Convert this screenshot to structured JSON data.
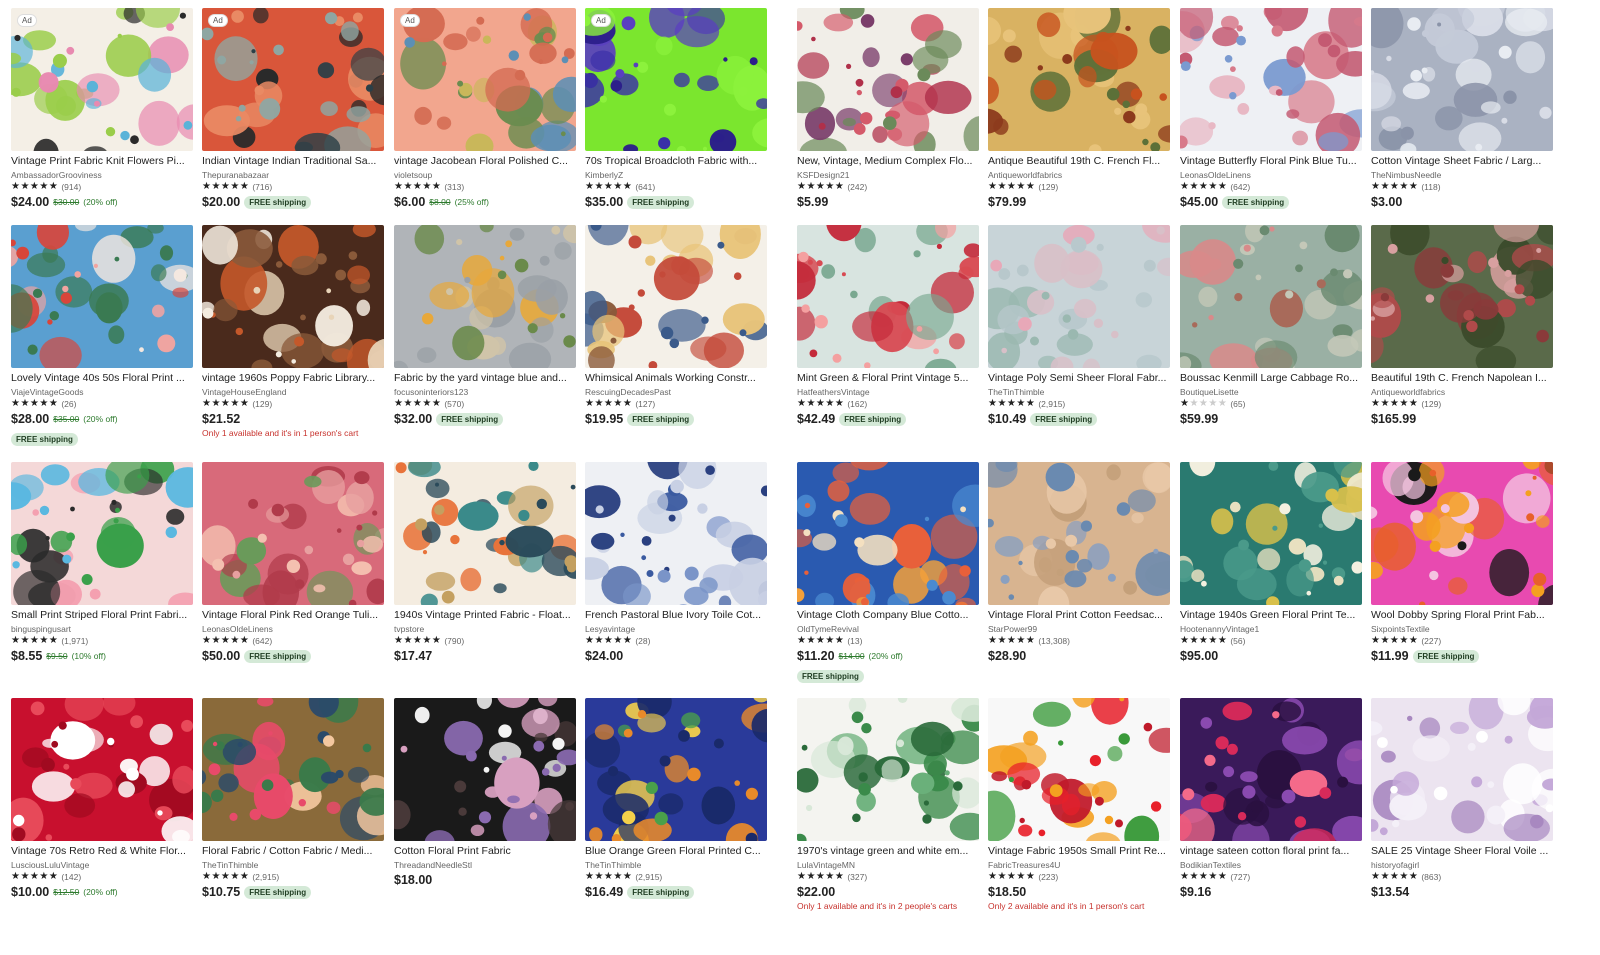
{
  "icons": {
    "star": "star-icon"
  },
  "colors": {
    "sale_green": "#2d7a2d",
    "badge_bg": "#d4e9d7",
    "alert_red": "#c7322d"
  },
  "free_shipping_label": "FREE shipping",
  "ad_label": "Ad",
  "listings": [
    {
      "title": "Vintage Print Fabric Knit Flowers Pi...",
      "shop": "AmbassadorGrooviness",
      "stars": 5,
      "reviews": "(914)",
      "price": "$24.00",
      "orig": "$30.00",
      "off": "(20% off)",
      "free": false,
      "ad": true,
      "alert": "",
      "pal": [
        "#f4efe6",
        "#5ab3d8",
        "#e88ab0",
        "#9acd4a",
        "#2a2a2a"
      ]
    },
    {
      "title": "Indian Vintage Indian Traditional Sa...",
      "shop": "Thepuranabazaar",
      "stars": 4.5,
      "reviews": "(716)",
      "price": "$20.00",
      "orig": "",
      "off": "",
      "free": true,
      "ad": true,
      "alert": "",
      "pal": [
        "#d9563a",
        "#2b3f47",
        "#8fa6a2",
        "#e98a64",
        "#2a2a2a"
      ]
    },
    {
      "title": "vintage Jacobean Floral Polished C...",
      "shop": "violetsoup",
      "stars": 5,
      "reviews": "(313)",
      "price": "$6.00",
      "orig": "$8.00",
      "off": "(25% off)",
      "free": false,
      "ad": true,
      "alert": "",
      "pal": [
        "#f2a68e",
        "#5c8fb5",
        "#c9b75a",
        "#6a8c4f",
        "#d46b52"
      ]
    },
    {
      "title": "70s Tropical Broadcloth Fabric with...",
      "shop": "KimberlyZ",
      "stars": 5,
      "reviews": "(641)",
      "price": "$35.00",
      "orig": "",
      "off": "",
      "free": true,
      "ad": true,
      "alert": "",
      "pal": [
        "#7be62e",
        "#3a2fa8",
        "#5a3fc0",
        "#8cf23c",
        "#2c1f8a"
      ]
    },
    {
      "title": "New, Vintage, Medium Complex Flo...",
      "shop": "KSFDesign21",
      "stars": 5,
      "reviews": "(242)",
      "price": "$5.99",
      "orig": "",
      "off": "",
      "free": false,
      "ad": false,
      "alert": "",
      "pal": [
        "#f1eee8",
        "#b0304a",
        "#6b8a5a",
        "#7b3e6b",
        "#d45a6a"
      ]
    },
    {
      "title": "Antique Beautiful 19th C. French Fl...",
      "shop": "Antiqueworldfabrics",
      "stars": 5,
      "reviews": "(129)",
      "price": "$79.99",
      "orig": "",
      "off": "",
      "free": false,
      "ad": false,
      "alert": "",
      "pal": [
        "#d9b262",
        "#c7521e",
        "#5c7038",
        "#8c3a1c",
        "#e8c37a"
      ]
    },
    {
      "title": "Vintage Butterfly Floral Pink Blue Tu...",
      "shop": "LeonasOldeLinens",
      "stars": 5,
      "reviews": "(642)",
      "price": "$45.00",
      "orig": "",
      "off": "",
      "free": true,
      "ad": false,
      "alert": "",
      "pal": [
        "#eef0f4",
        "#d87a8a",
        "#7a9ad0",
        "#e8b8c4",
        "#c45a72"
      ]
    },
    {
      "title": "Cotton Vintage Sheet Fabric / Larg...",
      "shop": "TheNimbusNeedle",
      "stars": 5,
      "reviews": "(118)",
      "price": "$3.00",
      "orig": "",
      "off": "",
      "free": false,
      "ad": false,
      "alert": "",
      "pal": [
        "#aab2c2",
        "#d8dce6",
        "#8a93a8",
        "#c4cad8",
        "#e8ecf2"
      ]
    },
    {
      "title": "Lovely Vintage 40s 50s Floral Print ...",
      "shop": "ViajeVintageGoods",
      "stars": 5,
      "reviews": "(26)",
      "price": "$28.00",
      "orig": "$35.00",
      "off": "(20% off)",
      "free": true,
      "ad": false,
      "alert": "",
      "pal": [
        "#5a9fd0",
        "#d8453a",
        "#f2a4a0",
        "#3a7a52",
        "#f4e8e0"
      ]
    },
    {
      "title": "vintage 1960s Poppy Fabric Library...",
      "shop": "VintageHouseEngland",
      "stars": 5,
      "reviews": "(129)",
      "price": "$21.52",
      "orig": "",
      "off": "",
      "free": false,
      "ad": false,
      "alert": "Only 1 available and it's in 1 person's cart",
      "pal": [
        "#4a2a1c",
        "#f4ece0",
        "#c4582a",
        "#8a5a3a",
        "#e8d4b8"
      ]
    },
    {
      "title": "Fabric by the yard vintage blue and...",
      "shop": "focusoninteriors123",
      "stars": 5,
      "reviews": "(570)",
      "price": "$32.00",
      "orig": "",
      "off": "",
      "free": true,
      "ad": false,
      "alert": "",
      "pal": [
        "#b0b4b8",
        "#e8a83a",
        "#6a8a4a",
        "#d0c4a8",
        "#9aa0a6"
      ]
    },
    {
      "title": "Whimsical Animals Working Constr...",
      "shop": "RescuingDecadesPast",
      "stars": 5,
      "reviews": "(127)",
      "price": "$19.95",
      "orig": "",
      "off": "",
      "free": true,
      "ad": false,
      "alert": "",
      "pal": [
        "#f4f0e8",
        "#c44a3a",
        "#3a5a8a",
        "#e8c47a",
        "#8a5a3a"
      ]
    },
    {
      "title": "Mint Green & Floral Print Vintage 5...",
      "shop": "HatfeathersVintage",
      "stars": 5,
      "reviews": "(162)",
      "price": "$42.49",
      "orig": "",
      "off": "",
      "free": true,
      "ad": false,
      "alert": "",
      "pal": [
        "#d8e4e0",
        "#d84a52",
        "#f4a0a0",
        "#7aa890",
        "#c42a3a"
      ]
    },
    {
      "title": "Vintage Poly Semi Sheer Floral Fabr...",
      "shop": "TheTinThimble",
      "stars": 5,
      "reviews": "(2,915)",
      "price": "$10.49",
      "orig": "",
      "off": "",
      "free": true,
      "ad": false,
      "alert": "",
      "pal": [
        "#c8d4d8",
        "#e8a8b8",
        "#9ab8b0",
        "#d8c0c8",
        "#b8c8cc"
      ]
    },
    {
      "title": "Boussac Kenmill Large Cabbage Ro...",
      "shop": "BoutiqueLisette",
      "stars": 1,
      "reviews": "(65)",
      "price": "$59.99",
      "orig": "",
      "off": "",
      "free": false,
      "ad": false,
      "alert": "",
      "pal": [
        "#9ab0a4",
        "#d88a8a",
        "#6a8a70",
        "#c4c8b8",
        "#a86a5a"
      ]
    },
    {
      "title": "Beautiful 19th C. French Napolean I...",
      "shop": "Antiqueworldfabrics",
      "stars": 5,
      "reviews": "(129)",
      "price": "$165.99",
      "orig": "",
      "off": "",
      "free": false,
      "ad": false,
      "alert": "",
      "pal": [
        "#5a6a4a",
        "#b04a4a",
        "#d8a0a0",
        "#3a4a2a",
        "#8a3a3a"
      ]
    },
    {
      "title": "Small Print Striped Floral Print Fabri...",
      "shop": "binguspingusart",
      "stars": 5,
      "reviews": "(1,971)",
      "price": "$8.55",
      "orig": "$9.50",
      "off": "(10% off)",
      "free": false,
      "ad": false,
      "alert": "",
      "pal": [
        "#f4d8d8",
        "#3aa04a",
        "#5ab8e0",
        "#2a2a2a",
        "#f4a0b0"
      ]
    },
    {
      "title": "Vintage Floral Pink Red Orange Tuli...",
      "shop": "LeonasOldeLinens",
      "stars": 5,
      "reviews": "(642)",
      "price": "$50.00",
      "orig": "",
      "off": "",
      "free": true,
      "ad": false,
      "alert": "",
      "pal": [
        "#d86a7a",
        "#e8a0a0",
        "#6a9a5a",
        "#f4c0b0",
        "#b03a4a"
      ]
    },
    {
      "title": "1940s Vintage Printed Fabric - Float...",
      "shop": "tvpstore",
      "stars": 5,
      "reviews": "(790)",
      "price": "$17.47",
      "orig": "",
      "off": "",
      "free": false,
      "ad": false,
      "alert": "",
      "pal": [
        "#f4ece0",
        "#e8733a",
        "#3a8a8a",
        "#c4a060",
        "#2a4a5a"
      ]
    },
    {
      "title": "French Pastoral Blue Ivory Toile Cot...",
      "shop": "Lesyavintage",
      "stars": 5,
      "reviews": "(28)",
      "price": "$24.00",
      "orig": "",
      "off": "",
      "free": false,
      "ad": false,
      "alert": "",
      "pal": [
        "#eef0f4",
        "#3a5aa0",
        "#7a94c8",
        "#c8d0e4",
        "#2a4080"
      ]
    },
    {
      "title": "Vintage Cloth Company Blue Cotto...",
      "shop": "OldTymeRevival",
      "stars": 5,
      "reviews": "(13)",
      "price": "$11.20",
      "orig": "$14.00",
      "off": "(20% off)",
      "free": true,
      "ad": false,
      "alert": "",
      "pal": [
        "#2a5ab0",
        "#e8603a",
        "#f4e0c0",
        "#4a8ad0",
        "#f4a03a"
      ]
    },
    {
      "title": "Vintage Floral Print Cotton Feedsac...",
      "shop": "StarPower99",
      "stars": 5,
      "reviews": "(13,308)",
      "price": "$28.90",
      "orig": "",
      "off": "",
      "free": false,
      "ad": false,
      "alert": "",
      "pal": [
        "#d8b490",
        "#6a8ab0",
        "#c4a07a",
        "#8aa0c0",
        "#e8c8a8"
      ]
    },
    {
      "title": "Vintage 1940s Green Floral Print Te...",
      "shop": "HootenannyVintage1",
      "stars": 5,
      "reviews": "(56)",
      "price": "$95.00",
      "orig": "",
      "off": "",
      "free": false,
      "ad": false,
      "alert": "",
      "pal": [
        "#2a7a70",
        "#e8e0c0",
        "#d8c04a",
        "#4a9a8a",
        "#f4f0e0"
      ]
    },
    {
      "title": "Wool Dobby Spring Floral Print Fab...",
      "shop": "SixpointsTextile",
      "stars": 5,
      "reviews": "(227)",
      "price": "$11.99",
      "orig": "",
      "off": "",
      "free": true,
      "ad": false,
      "alert": "",
      "pal": [
        "#e84ab0",
        "#f4a020",
        "#1a1a1a",
        "#f4c4e0",
        "#e8602a"
      ]
    },
    {
      "title": "Vintage 70s Retro Red & White Flor...",
      "shop": "LusciousLuluVintage",
      "stars": 5,
      "reviews": "(142)",
      "price": "$10.00",
      "orig": "$12.50",
      "off": "(20% off)",
      "free": false,
      "ad": false,
      "alert": "",
      "pal": [
        "#c8102e",
        "#f4f0f0",
        "#a00a20",
        "#e84a5a",
        "#ffffff"
      ]
    },
    {
      "title": "Floral Fabric / Cotton Fabric / Medi...",
      "shop": "TheTinThimble",
      "stars": 5,
      "reviews": "(2,915)",
      "price": "$10.75",
      "orig": "",
      "off": "",
      "free": true,
      "ad": false,
      "alert": "",
      "pal": [
        "#8a6a3a",
        "#e84a6a",
        "#3a7a4a",
        "#f4c8a0",
        "#2a4a6a"
      ]
    },
    {
      "title": "Cotton Floral Print Fabric",
      "shop": "ThreadandNeedleStl",
      "stars": 0,
      "reviews": "",
      "price": "$18.00",
      "orig": "",
      "off": "",
      "free": false,
      "ad": false,
      "alert": "",
      "pal": [
        "#1a1a1a",
        "#f4f4f4",
        "#d8a0c0",
        "#8a6ab0",
        "#4a3a3a"
      ]
    },
    {
      "title": "Blue Orange Green Floral Printed C...",
      "shop": "TheTinThimble",
      "stars": 5,
      "reviews": "(2,915)",
      "price": "$16.49",
      "orig": "",
      "off": "",
      "free": true,
      "ad": false,
      "alert": "",
      "pal": [
        "#2a3a9a",
        "#e88a2a",
        "#4aa04a",
        "#f4d04a",
        "#1a2a6a"
      ]
    },
    {
      "title": "1970's vintage green and white em...",
      "shop": "LulaVintageMN",
      "stars": 5,
      "reviews": "(327)",
      "price": "$22.00",
      "orig": "",
      "off": "",
      "free": false,
      "ad": false,
      "alert": "Only 1 available and it's in 2 people's carts",
      "pal": [
        "#f4f4f0",
        "#3a8a4a",
        "#6ab07a",
        "#d8e8d8",
        "#2a6a3a"
      ]
    },
    {
      "title": "Vintage Fabric 1950s Small Print Re...",
      "shop": "FabricTreasures4U",
      "stars": 4.5,
      "reviews": "(223)",
      "price": "$18.50",
      "orig": "",
      "off": "",
      "free": false,
      "ad": false,
      "alert": "Only 2 available and it's in 1 person's cart",
      "pal": [
        "#f8f8f8",
        "#e8202a",
        "#3a9a3a",
        "#f4a020",
        "#c01a2a"
      ]
    },
    {
      "title": "vintage sateen cotton floral print fa...",
      "shop": "BodikianTextiles",
      "stars": 5,
      "reviews": "(727)",
      "price": "$9.16",
      "orig": "",
      "off": "",
      "free": false,
      "ad": false,
      "alert": "",
      "pal": [
        "#3a1a5a",
        "#d82a5a",
        "#8a4ab0",
        "#f46a8a",
        "#2a1040"
      ]
    },
    {
      "title": "SALE 25 Vintage Sheer Floral Voile ...",
      "shop": "historyofagirl",
      "stars": 5,
      "reviews": "(863)",
      "price": "$13.54",
      "orig": "",
      "off": "",
      "free": false,
      "ad": false,
      "alert": "",
      "pal": [
        "#ece4f0",
        "#c4a8d8",
        "#f4f0f8",
        "#a888c0",
        "#ffffff"
      ]
    }
  ]
}
